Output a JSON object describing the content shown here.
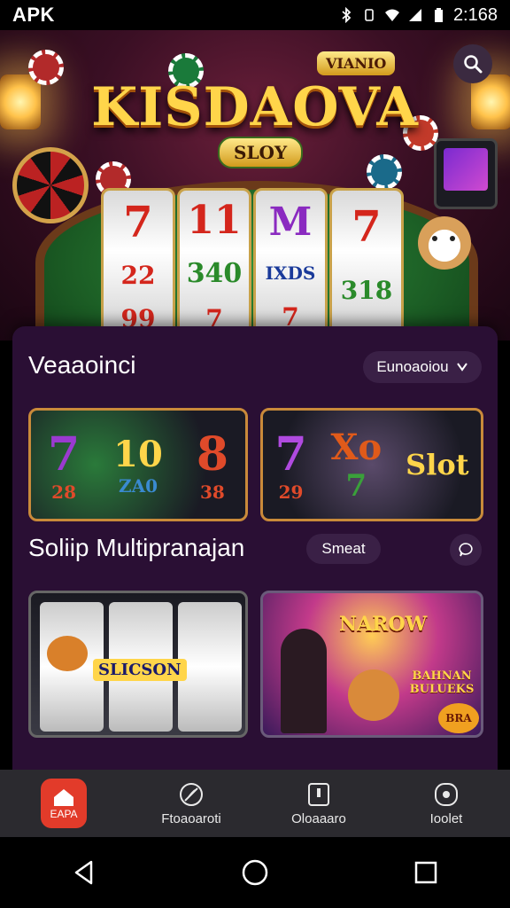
{
  "status_bar": {
    "left_text": "APK",
    "time": "2:168"
  },
  "hero": {
    "logo_title": "KISDAOVA",
    "top_tag": "VIANIO",
    "slot_tag": "SLOY",
    "reels": [
      {
        "top": "7",
        "middle": "22",
        "bottom": "99"
      },
      {
        "top": "11",
        "middle": "340",
        "bottom": "7"
      },
      {
        "top": "M",
        "middle": "IXDS",
        "bottom": "7"
      },
      {
        "top": "7",
        "middle": "318",
        "bottom": ""
      }
    ]
  },
  "section1": {
    "title": "Veaaoinci",
    "pill_label": "Eunoaoiou",
    "cards": [
      {
        "symbols": [
          {
            "big": "7",
            "small": "28"
          },
          {
            "big": "10",
            "small": "ZA0"
          },
          {
            "big": "8",
            "small": "38"
          }
        ]
      },
      {
        "symbols": [
          {
            "big": "7",
            "small": "29"
          },
          {
            "big": "Xo",
            "small": "7"
          },
          {
            "big": "Slot",
            "small": ""
          }
        ]
      }
    ]
  },
  "section2": {
    "title": "Soliip Multipranajan",
    "pill_label": "Smeat",
    "cards": [
      {
        "top_label": "",
        "reel_text": "SLICSON",
        "bottom_label": ""
      },
      {
        "banner_top": "NAROW",
        "banner_side": "BAHNAN BULUEKS",
        "badge": "BRA"
      }
    ]
  },
  "nav": {
    "items": [
      {
        "label": "EAPA",
        "icon": "home-icon",
        "active": true
      },
      {
        "label": "Ftoaoaroti",
        "icon": "leaf-icon",
        "active": false
      },
      {
        "label": "Oloaaaro",
        "icon": "info-icon",
        "active": false
      },
      {
        "label": "Ioolet",
        "icon": "profile-icon",
        "active": false
      }
    ]
  },
  "colors": {
    "accent_red": "#e23b2a",
    "gold": "#ffd54a",
    "panel": "#2a0f34",
    "card_border": "#c98a3a"
  }
}
